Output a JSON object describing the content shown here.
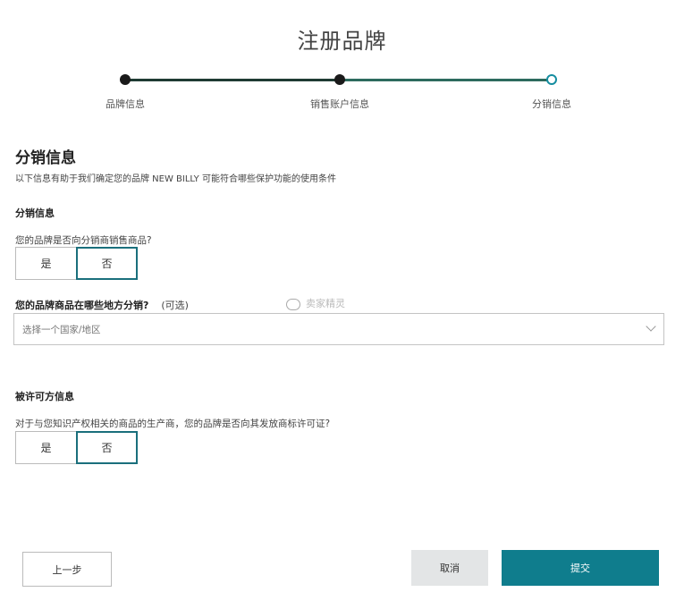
{
  "page": {
    "title": "注册品牌"
  },
  "stepper": {
    "steps": [
      {
        "label": "品牌信息",
        "state": "completed"
      },
      {
        "label": "销售账户信息",
        "state": "completed"
      },
      {
        "label": "分销信息",
        "state": "current"
      }
    ]
  },
  "section": {
    "title": "分销信息",
    "description": "以下信息有助于我们确定您的品牌 NEW BILLY 可能符合哪些保护功能的使用条件"
  },
  "distribution": {
    "subtitle": "分销信息",
    "question": "您的品牌是否向分销商销售商品?",
    "options": [
      "是",
      "否"
    ],
    "selected": "否"
  },
  "region": {
    "question": "您的品牌商品在哪些地方分销?",
    "optional": "(可选)",
    "placeholder": "选择一个国家/地区"
  },
  "watermark": {
    "text": "卖家精灵"
  },
  "licensee": {
    "subtitle": "被许可方信息",
    "question": "对于与您知识产权相关的商品的生产商，您的品牌是否向其发放商标许可证?",
    "options": [
      "是",
      "否"
    ],
    "selected": "否"
  },
  "footer": {
    "prev_label": "上一步",
    "cancel_label": "取消",
    "submit_label": "提交"
  },
  "colors": {
    "accent": "#0f7d8d",
    "step_done": "#1a1a1a",
    "step_current": "#158da0"
  }
}
